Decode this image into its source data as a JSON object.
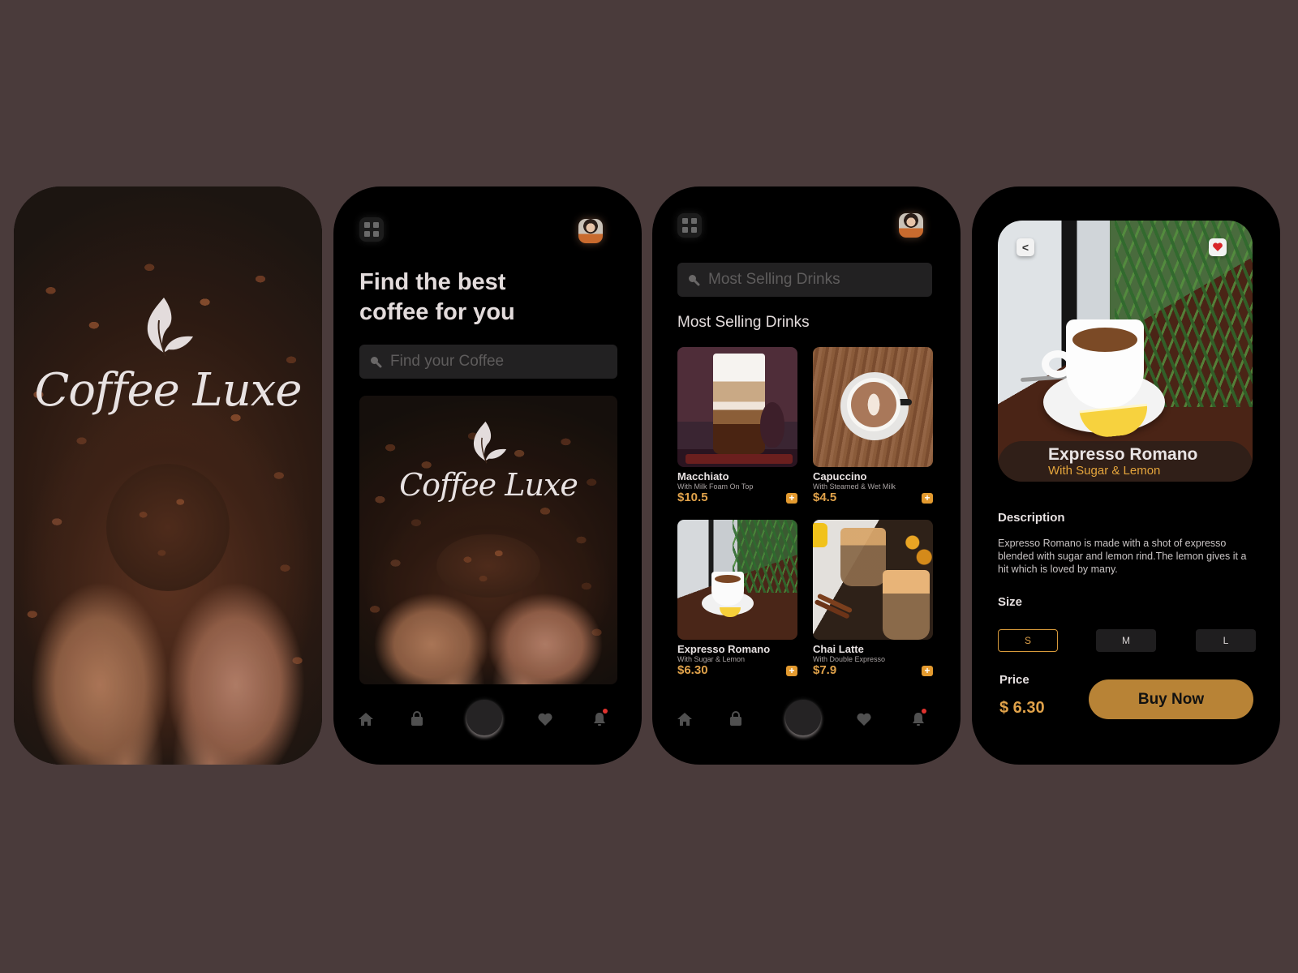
{
  "brand": {
    "name": "Coffee Luxe",
    "accent_color": "#b88336",
    "price_color": "#e0a24a",
    "background_color": "#4a3b3b"
  },
  "screen1_splash": {
    "logo_text": "Coffee Luxe",
    "logo_icon": "leaf-icon"
  },
  "screen2_home": {
    "menu_icon": "grid-menu-icon",
    "avatar_icon": "user-avatar",
    "headline_line1": "Find the best",
    "headline_line2": "coffee for you",
    "search": {
      "placeholder": "Find your Coffee",
      "value": "",
      "icon": "search-icon"
    },
    "hero": {
      "logo_text": "Coffee Luxe"
    }
  },
  "screen3_list": {
    "search": {
      "placeholder": "Most Selling Drinks",
      "value": ""
    },
    "section_title": "Most Selling Drinks",
    "products": [
      {
        "name": "Macchiato",
        "subtitle": "With Milk Foam On Top",
        "price": "$10.5",
        "add_label": "+"
      },
      {
        "name": "Capuccino",
        "subtitle": "With Steamed & Wet Milk",
        "price": "$4.5",
        "add_label": "+"
      },
      {
        "name": "Expresso Romano",
        "subtitle": "With Sugar & Lemon",
        "price": "$6.30",
        "add_label": "+"
      },
      {
        "name": "Chai Latte",
        "subtitle": "With Double Expresso",
        "price": "$7.9",
        "add_label": "+"
      }
    ]
  },
  "bottom_nav": {
    "items": [
      "home-icon",
      "bag-icon",
      "center-button",
      "heart-icon",
      "bell-icon"
    ],
    "notification_dot": true
  },
  "screen4_detail": {
    "back_label": "<",
    "favorite": true,
    "title": "Expresso Romano",
    "subtitle": "With Sugar & Lemon",
    "description_label": "Description",
    "description": "Expresso Romano is made with a shot of expresso blended with sugar and lemon rind.The lemon gives it a hit which is loved by many.",
    "size_label": "Size",
    "sizes": [
      "S",
      "M",
      "L"
    ],
    "selected_size": "S",
    "price_label": "Price",
    "price": "$ 6.30",
    "buy_label": "Buy Now"
  }
}
